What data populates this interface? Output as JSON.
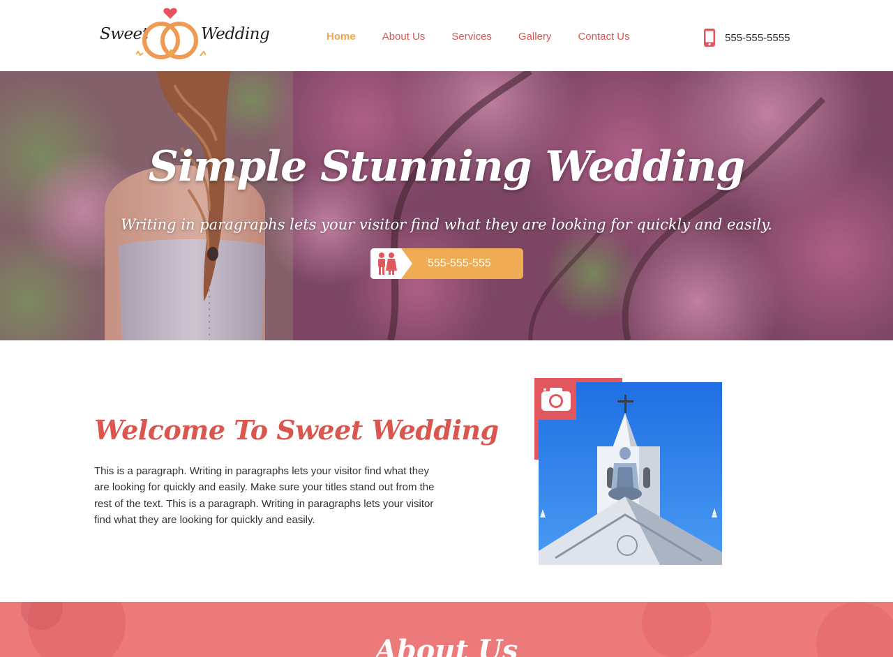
{
  "header": {
    "logo": {
      "left_word": "Sweet",
      "right_word": "Wedding"
    },
    "nav": [
      {
        "label": "Home",
        "active": true
      },
      {
        "label": "About Us",
        "active": false
      },
      {
        "label": "Services",
        "active": false
      },
      {
        "label": "Gallery",
        "active": false
      },
      {
        "label": "Contact Us",
        "active": false
      }
    ],
    "phone": "555-555-5555",
    "phone_icon": "mobile-phone-icon"
  },
  "hero": {
    "title": "Simple Stunning Wedding",
    "subtitle": "Writing in paragraphs lets your visitor find what they are looking for quickly and easily.",
    "button_label": "555-555-555",
    "button_icon": "couple-icon"
  },
  "welcome": {
    "title": "Welcome To Sweet Wedding",
    "paragraph": "This is a paragraph. Writing in paragraphs lets your visitor find what they are looking for quickly and easily. Make sure your titles stand out from the rest of the text. This is a paragraph. Writing in paragraphs lets your visitor find what they are looking for quickly and easily.",
    "photo_icon": "camera-icon"
  },
  "about": {
    "title": "About Us"
  },
  "colors": {
    "accent_red": "#d9574f",
    "accent_orange": "#efa94c",
    "band_pink": "#ec7a7a"
  }
}
